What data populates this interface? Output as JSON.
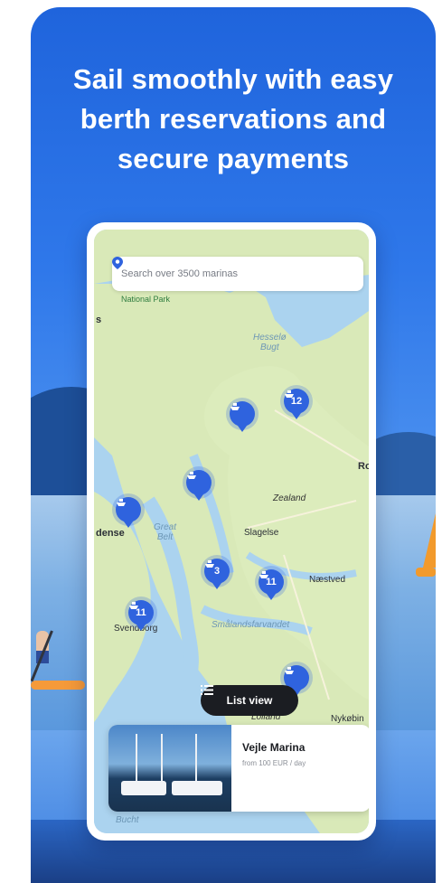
{
  "headline": [
    "Sail smoothly with easy",
    "berth reservations and",
    "secure payments"
  ],
  "search": {
    "placeholder": "Search over 3500 marinas",
    "icon": "location-pin-icon"
  },
  "map": {
    "labels": {
      "national_park": "National Park",
      "edge_s": "s",
      "hesselo": [
        "Hesselø",
        "Bugt"
      ],
      "edge_ro": "Ro",
      "zealand": "Zealand",
      "odense": "dense",
      "great_belt": [
        "Great",
        "Belt"
      ],
      "slagelse": "Slagelse",
      "naestved": "Næstved",
      "svendborg": "Svendborg",
      "smalands": "Smålandsfarvandet",
      "lolland": "Lolland",
      "nykobing": "Nykøbin",
      "bucht": "Bucht"
    },
    "markers": [
      {
        "count": "12"
      },
      {
        "count": ""
      },
      {
        "count": ""
      },
      {
        "count": ""
      },
      {
        "count": "3"
      },
      {
        "count": "11"
      },
      {
        "count": "11"
      },
      {
        "count": ""
      }
    ]
  },
  "list_view": {
    "label": "List view"
  },
  "marina_card": {
    "name": "Vejle Marina",
    "price": "from 100 EUR / day"
  },
  "colors": {
    "brand_blue": "#2f63de",
    "background_blue": "#2f78ea",
    "land": "#d9e9b8",
    "water": "#abd3ef"
  }
}
